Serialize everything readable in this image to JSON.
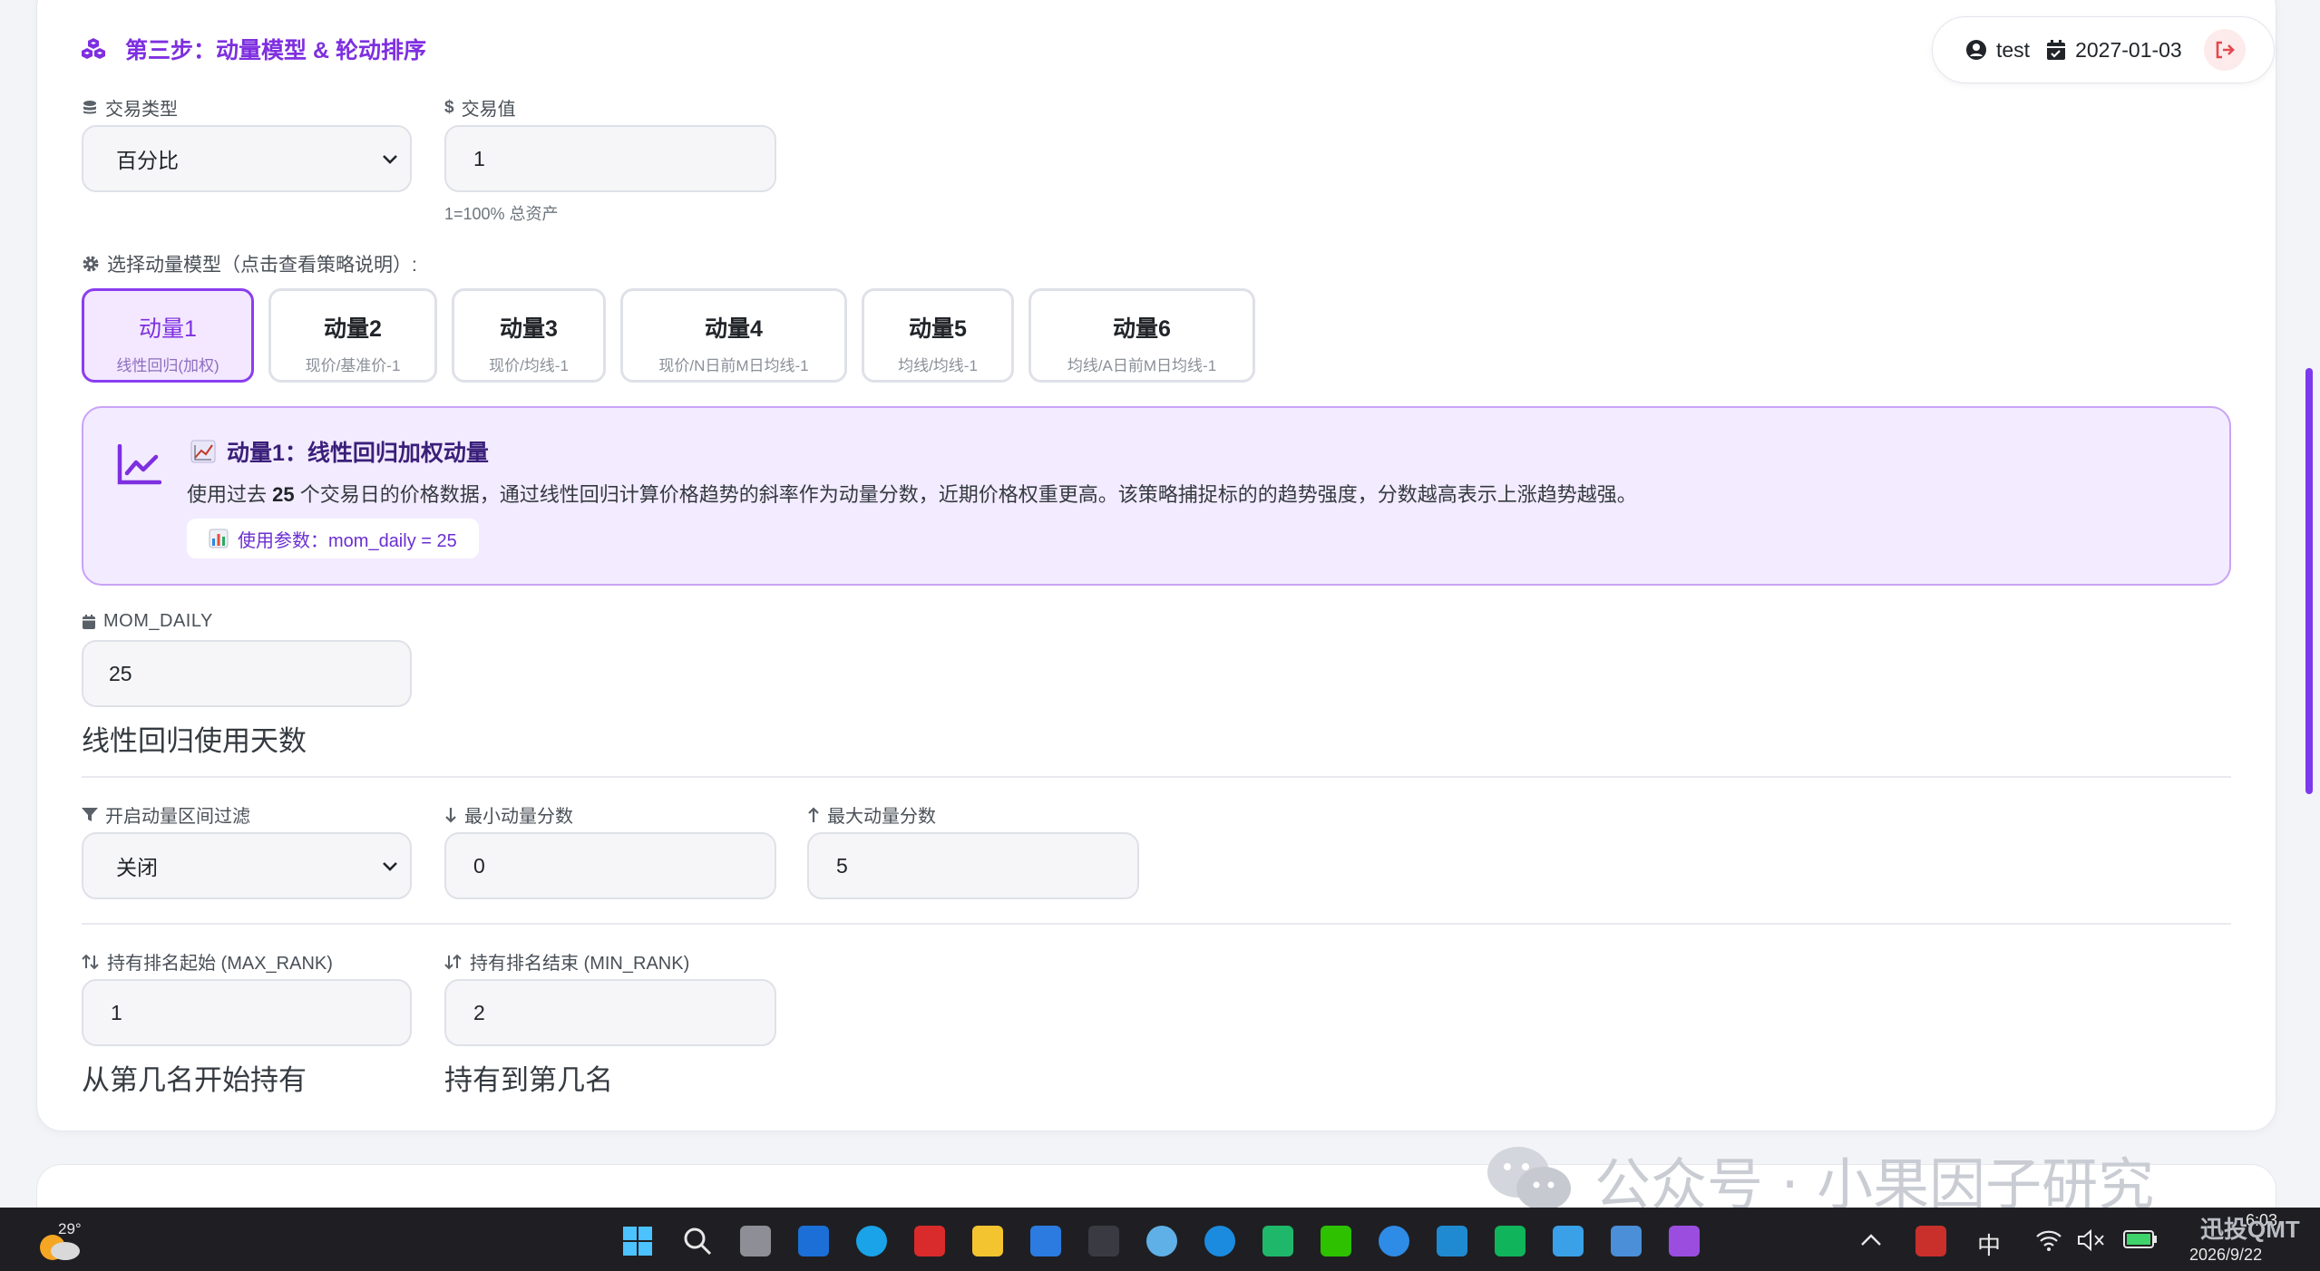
{
  "header": {
    "section_title": "第三步：动量模型 & 轮动排序",
    "user": "test",
    "date": "2027-01-03"
  },
  "trade": {
    "type_label": "交易类型",
    "type_value": "百分比",
    "value_label": "交易值",
    "value": "1",
    "value_hint": "1=100% 总资产"
  },
  "models": {
    "label": "选择动量模型（点击查看策略说明）:",
    "items": [
      {
        "title": "动量1",
        "sub": "线性回归(加权)"
      },
      {
        "title": "动量2",
        "sub": "现价/基准价-1"
      },
      {
        "title": "动量3",
        "sub": "现价/均线-1"
      },
      {
        "title": "动量4",
        "sub": "现价/N日前M日均线-1"
      },
      {
        "title": "动量5",
        "sub": "均线/均线-1"
      },
      {
        "title": "动量6",
        "sub": "均线/A日前M日均线-1"
      }
    ]
  },
  "description": {
    "title": "动量1：线性回归加权动量",
    "text_pre": "使用过去",
    "text_bold": "25",
    "text_post": "个交易日的价格数据，通过线性回归计算价格趋势的斜率作为动量分数，近期价格权重更高。该策略捕捉标的的趋势强度，分数越高表示上涨趋势越强。",
    "param": "使用参数：mom_daily = 25"
  },
  "mom_daily": {
    "label": "MOM_DAILY",
    "value": "25",
    "hint": "线性回归使用天数"
  },
  "filter": {
    "enable_label": "开启动量区间过滤",
    "enable_value": "关闭",
    "min_label": "最小动量分数",
    "min_value": "0",
    "max_label": "最大动量分数",
    "max_value": "5"
  },
  "rank": {
    "start_label": "持有排名起始 (MAX_RANK)",
    "start_value": "1",
    "start_hint": "从第几名开始持有",
    "end_label": "持有排名结束 (MIN_RANK)",
    "end_value": "2",
    "end_hint": "持有到第几名"
  },
  "watermark": "公众号 · 小果因子研究",
  "taskbar": {
    "weather": "29°",
    "ime": "中",
    "time": "6:03",
    "date": "2026/9/22",
    "brand": "迅投QMT"
  },
  "colors": {
    "accent": "#7e2fe0",
    "accent_light": "#f3e8ff",
    "danger": "#e5484d"
  }
}
